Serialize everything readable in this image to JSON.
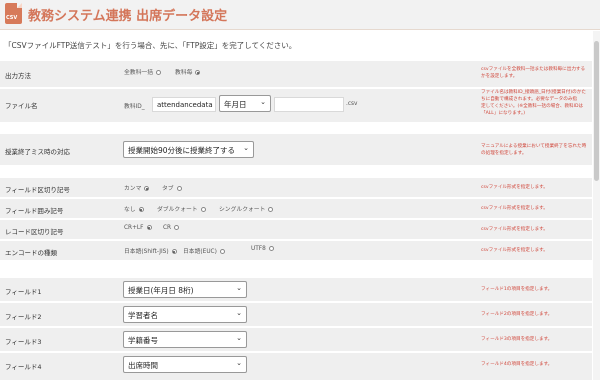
{
  "header": {
    "title": "教務システム連携 出席データ設定",
    "logo_text": "CSV"
  },
  "intro_text": "「CSVファイルFTP送信テスト」を行う場合、先に、「FTP設定」を完了してください。",
  "output_method": {
    "label": "出力方法",
    "options": [
      "全教科一括",
      "教科毎"
    ],
    "note": "csvファイルを全教科一括または教科毎に出力する\nかを設定します。"
  },
  "file_name": {
    "label": "ファイル名",
    "prefix": "教科ID_",
    "name_value": "attendancedata",
    "date_select": "年月日",
    "extra_value": "",
    "suffix": ".csv",
    "note": "ファイル名は教科ID_接頭語_日付(授業日付)のかた\nちに自動で構成されます。必要なデータのみ指\n定してください。(※全教科一括の場合、教科IDは\n「ALL」になります。)"
  },
  "class_end_miss": {
    "label": "授業終了ミス時の対応",
    "select_value": "授業開始90分後に授業終了する",
    "note": "マニュアルによる授業において授業終了を忘れた時\nの処理を指定します。"
  },
  "field_delimiter": {
    "label": "フィールド区切り記号",
    "options": [
      "カンマ",
      "タブ"
    ],
    "note": "csvファイル形式を指定します。"
  },
  "field_enclosure": {
    "label": "フィールド囲み記号",
    "options": [
      "なし",
      "ダブルクォート",
      "シングルクォート"
    ],
    "note": "csvファイル形式を指定します。"
  },
  "record_delimiter": {
    "label": "レコード区切り記号",
    "options": [
      "CR+LF",
      "CR"
    ],
    "note": "csvファイル形式を指定します。"
  },
  "encoding": {
    "label": "エンコードの種類",
    "options": [
      "日本語(Shift-JIS)",
      "日本語(EUC)",
      "UTF8"
    ],
    "note": "csvファイル形式を指定します。"
  },
  "fields": [
    {
      "label": "フィールド1",
      "value": "授業日(年月日 8桁)",
      "note": "フィールド1の項目を指定します。"
    },
    {
      "label": "フィールド2",
      "value": "学習者名",
      "note": "フィールド2の項目を指定します。"
    },
    {
      "label": "フィールド3",
      "value": "学籍番号",
      "note": "フィールド3の項目を指定します。"
    },
    {
      "label": "フィールド4",
      "value": "出席時間",
      "note": "フィールド4の項目を指定します。"
    }
  ],
  "select_arrow": "⌄"
}
